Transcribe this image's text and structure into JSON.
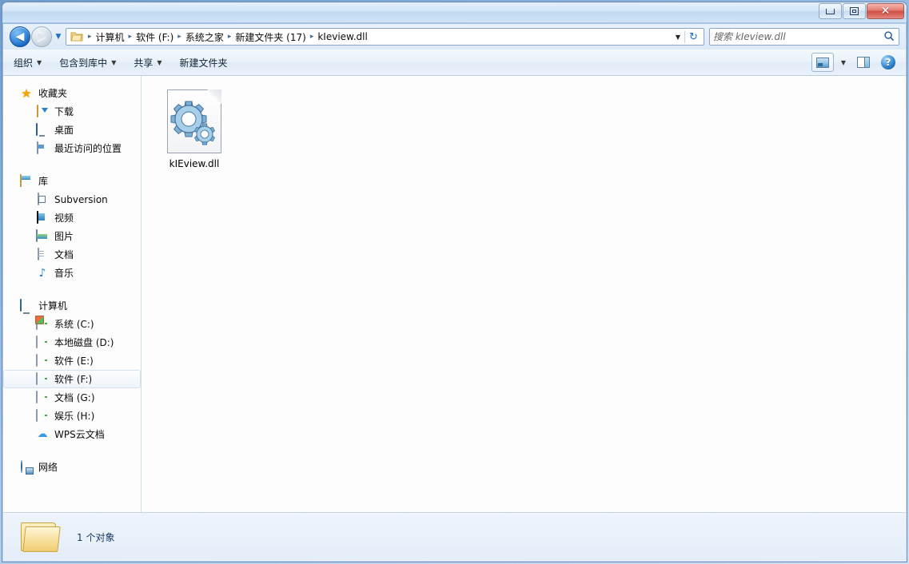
{
  "window": {
    "buttons": {
      "minimize": "最小化",
      "maximize": "最大化",
      "close": "关闭",
      "close_glyph": "✕"
    }
  },
  "navigation": {
    "back_label": "后退",
    "back_glyph": "◀",
    "forward_label": "前进",
    "forward_glyph": "▶",
    "history_glyph": "▼",
    "refresh_glyph": "↻",
    "address_dropdown_glyph": "▼"
  },
  "address": {
    "folder_icon": "folder-icon",
    "separator": "▸",
    "crumbs": [
      "计算机",
      "软件 (F:)",
      "系统之家",
      "新建文件夹 (17)",
      "kIeview.dll"
    ]
  },
  "search": {
    "placeholder": "搜索 kIeview.dll",
    "value": "",
    "icon": "search-icon"
  },
  "toolbar": {
    "items": [
      {
        "label": "组织",
        "has_caret": true
      },
      {
        "label": "包含到库中",
        "has_caret": true
      },
      {
        "label": "共享",
        "has_caret": true
      },
      {
        "label": "新建文件夹",
        "has_caret": false
      }
    ],
    "caret_glyph": "▼",
    "view_button": "更改您的视图",
    "view_caret": "▼",
    "preview_button": "显示预览窗格",
    "help_button": "获取帮助",
    "help_glyph": "?"
  },
  "sidebar": {
    "groups": [
      {
        "root": {
          "label": "收藏夹",
          "icon": "star-icon"
        },
        "children": [
          {
            "label": "下载",
            "icon": "downloads-icon"
          },
          {
            "label": "桌面",
            "icon": "desktop-icon"
          },
          {
            "label": "最近访问的位置",
            "icon": "recent-places-icon"
          }
        ]
      },
      {
        "root": {
          "label": "库",
          "icon": "library-icon"
        },
        "children": [
          {
            "label": "Subversion",
            "icon": "subversion-icon"
          },
          {
            "label": "视频",
            "icon": "video-icon"
          },
          {
            "label": "图片",
            "icon": "pictures-icon"
          },
          {
            "label": "文档",
            "icon": "documents-icon"
          },
          {
            "label": "音乐",
            "icon": "music-icon"
          }
        ]
      },
      {
        "root": {
          "label": "计算机",
          "icon": "computer-icon"
        },
        "children": [
          {
            "label": "系统 (C:)",
            "icon": "system-drive-icon",
            "selected": false
          },
          {
            "label": "本地磁盘 (D:)",
            "icon": "drive-icon",
            "selected": false
          },
          {
            "label": "软件 (E:)",
            "icon": "drive-icon",
            "selected": false
          },
          {
            "label": "软件 (F:)",
            "icon": "drive-icon",
            "selected": true
          },
          {
            "label": "文档 (G:)",
            "icon": "drive-icon",
            "selected": false
          },
          {
            "label": "娱乐 (H:)",
            "icon": "drive-icon",
            "selected": false
          },
          {
            "label": "WPS云文档",
            "icon": "cloud-icon",
            "selected": false
          }
        ]
      },
      {
        "root": {
          "label": "网络",
          "icon": "network-icon"
        },
        "children": []
      }
    ]
  },
  "content": {
    "files": [
      {
        "name": "kIEview.dll",
        "icon": "dll-file-icon",
        "selected": false
      }
    ]
  },
  "statusbar": {
    "icon": "folder-icon",
    "text": "1 个对象"
  },
  "colors": {
    "accent": "#1767c0",
    "close_red": "#cf4f44",
    "window_bg": "#fdfdfd",
    "status_text": "#12375e"
  }
}
